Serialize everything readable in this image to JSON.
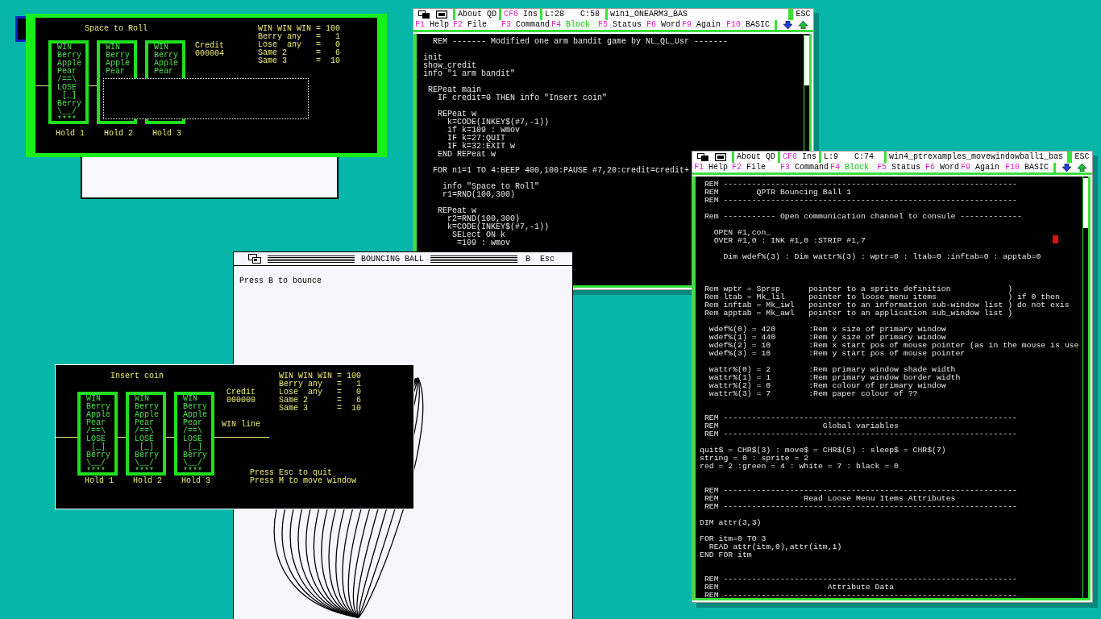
{
  "editors": [
    {
      "about": "About QD",
      "mode_key": "CF6",
      "mode": "Ins",
      "line": "L:28",
      "column": "C:58",
      "file": "win1_ONEARM3_BAS",
      "escape": "ESC",
      "cursor": false,
      "menu": [
        {
          "key": "F1",
          "label": "Help",
          "active": false
        },
        {
          "key": "F2",
          "label": "File",
          "active": false
        },
        {
          "key": "F3",
          "label": "Command",
          "active": false
        },
        {
          "key": "F4",
          "label": "Block",
          "active": true
        },
        {
          "key": "F5",
          "label": "Status",
          "active": false
        },
        {
          "key": "F6",
          "label": "Word",
          "active": false
        },
        {
          "key": "F9",
          "label": "Again",
          "active": false
        },
        {
          "key": "F10",
          "label": "BASIC",
          "active": false
        }
      ],
      "lines": [
        {
          "kind": "code",
          "text": "  REM ------- Modified one arm bandit game by NL_QL_Usr -------"
        },
        {
          "kind": "blank"
        },
        {
          "kind": "code",
          "text": "init"
        },
        {
          "kind": "code",
          "text": "show_credit"
        },
        {
          "kind": "code",
          "text": "info \"1 arm bandit\""
        },
        {
          "kind": "blank"
        },
        {
          "kind": "code",
          "text": " REPeat main"
        },
        {
          "kind": "code",
          "text": "   IF credit=0 THEN info \"Insert coin\""
        },
        {
          "kind": "blank"
        },
        {
          "kind": "code",
          "text": "   REPeat w"
        },
        {
          "kind": "code",
          "text": "     k=CODE(INKEY$(#7,-1))"
        },
        {
          "kind": "code",
          "text": "     if k=109 : wmov"
        },
        {
          "kind": "code",
          "text": "     IF k=27:QUIT"
        },
        {
          "kind": "code",
          "text": "     IF k=32:EXIT w"
        },
        {
          "kind": "code",
          "text": "   END REPeat w"
        },
        {
          "kind": "blank"
        },
        {
          "kind": "code",
          "text": "  FOR n1=1 TO 4:BEEP 400,100:PAUSE #7,20:credit=credit+"
        },
        {
          "kind": "blank"
        },
        {
          "kind": "code",
          "text": "    info \"Space to Roll\""
        },
        {
          "kind": "code",
          "text": "    r1=RND(100,300)"
        },
        {
          "kind": "blank"
        },
        {
          "kind": "code",
          "text": "   REPeat w"
        },
        {
          "kind": "code",
          "text": "     r2=RND(100,300)"
        },
        {
          "kind": "code",
          "text": "     k=CODE(INKEY$(#7,-1))"
        },
        {
          "kind": "code",
          "text": "      SELect ON k"
        },
        {
          "kind": "code",
          "text": "       =109 : wmov"
        }
      ]
    },
    {
      "about": "About QD",
      "mode_key": "CF6",
      "mode": "Ins",
      "line": "L:9",
      "column": "C:74",
      "file": "win4_ptrexamples_movewindowball1_bas",
      "escape": "ESC",
      "cursor": true,
      "menu": [
        {
          "key": "F1",
          "label": "Help",
          "active": false
        },
        {
          "key": "F2",
          "label": "File",
          "active": false
        },
        {
          "key": "F3",
          "label": "Command",
          "active": false
        },
        {
          "key": "F4",
          "label": "Block",
          "active": true
        },
        {
          "key": "F5",
          "label": "Status",
          "active": false
        },
        {
          "key": "F6",
          "label": "Word",
          "active": false
        },
        {
          "key": "F9",
          "label": "Again",
          "active": false
        },
        {
          "key": "F10",
          "label": "BASIC",
          "active": false
        }
      ],
      "lines": [
        {
          "kind": "code",
          "text": " REM --------------------------------------------------------------"
        },
        {
          "kind": "code",
          "text": " REM        QPTR Bouncing Ball 1"
        },
        {
          "kind": "code",
          "text": " REM --------------------------------------------------------------"
        },
        {
          "kind": "blank"
        },
        {
          "kind": "code",
          "text": " Rem ----------- Open communication channel to consule -------------"
        },
        {
          "kind": "blank"
        },
        {
          "kind": "code",
          "text": "   OPEN #1,con_"
        },
        {
          "kind": "code",
          "text": "   OVER #1,0 : INK #1,0 :STRIP #1,7"
        },
        {
          "kind": "blank"
        },
        {
          "kind": "code",
          "text": "     Dim wdef%(3) : Dim wattr%(3) : wptr=0 : ltab=0 :inftab=0 : apptab=0"
        },
        {
          "kind": "blank"
        },
        {
          "kind": "blank"
        },
        {
          "kind": "blank"
        },
        {
          "kind": "code",
          "text": " Rem wptr = Sprsp      pointer to a sprite definition            )"
        },
        {
          "kind": "code",
          "text": " Rem ltab = Mk_lil     pointer to loose menu items               ) if 0 then"
        },
        {
          "kind": "code",
          "text": " Rem inftab = Mk_iwl   pointer to an information sub-window list ) do not exis"
        },
        {
          "kind": "code",
          "text": " Rem apptab = Mk_awl   pointer to an application sub_window list )"
        },
        {
          "kind": "blank"
        },
        {
          "kind": "code",
          "text": "  wdef%(0) = 420       :Rem x size of primary window"
        },
        {
          "kind": "code",
          "text": "  wdef%(1) = 440       :Rem y size of primary window"
        },
        {
          "kind": "code",
          "text": "  wdef%(2) = 10        :Rem x start pos of mouse pointer (as in the mouse is use"
        },
        {
          "kind": "code",
          "text": "  wdef%(3) = 10        :Rem y start pos of mouse pointer"
        },
        {
          "kind": "blank"
        },
        {
          "kind": "code",
          "text": "  wattr%(0) = 2        :Rem primary window shade width"
        },
        {
          "kind": "code",
          "text": "  wattr%(1) = 1        :Rem primary window border width"
        },
        {
          "kind": "code",
          "text": "  wattr%(2) = 0        :Rem colour of primary window"
        },
        {
          "kind": "code",
          "text": "  wattr%(3) = 7        :Rem paper colour of ??"
        },
        {
          "kind": "blank"
        },
        {
          "kind": "blank"
        },
        {
          "kind": "code",
          "text": " REM --------------------------------------------------------------"
        },
        {
          "kind": "code",
          "text": " REM                      Global variables"
        },
        {
          "kind": "code",
          "text": " REM --------------------------------------------------------------"
        },
        {
          "kind": "blank"
        },
        {
          "kind": "code",
          "text": "quit$ = CHR$(3) : move$ = CHR$(5) : sleep$ = CHR$(7)"
        },
        {
          "kind": "code",
          "text": "string = 0 : sprite = 2"
        },
        {
          "kind": "code",
          "text": "red = 2 :green = 4 : white = 7 : black = 0"
        },
        {
          "kind": "blank"
        },
        {
          "kind": "blank"
        },
        {
          "kind": "code",
          "text": " REM --------------------------------------------------------------"
        },
        {
          "kind": "code",
          "text": " REM                  Read Loose Menu Items Attributes"
        },
        {
          "kind": "code",
          "text": " REM --------------------------------------------------------------"
        },
        {
          "kind": "blank"
        },
        {
          "kind": "code",
          "text": "DIM attr(3,3)"
        },
        {
          "kind": "blank"
        },
        {
          "kind": "code",
          "text": "FOR itm=0 TO 3"
        },
        {
          "kind": "code",
          "text": "  READ attr(itm,0),attr(itm,1)"
        },
        {
          "kind": "code",
          "text": "END FOR itm"
        },
        {
          "kind": "blank"
        },
        {
          "kind": "blank"
        },
        {
          "kind": "code",
          "text": " REM --------------------------------------------------------------"
        },
        {
          "kind": "code",
          "text": " REM                       Attribute Data"
        },
        {
          "kind": "code",
          "text": " REM --------------------------------------------------------------"
        }
      ]
    }
  ],
  "bouncing_ball": {
    "title": "BOUNCING BALL",
    "keys": [
      "B",
      "Esc"
    ],
    "message": "Press B to bounce"
  },
  "games": [
    {
      "info": "Space to Roll",
      "overlay": true,
      "reels": [
        {
          "symbols": [
            "WIN",
            "Berry",
            "Apple",
            "Pear",
            "/==\\",
            "LOSE",
            " [_]",
            "Berry",
            "\\__/",
            "****"
          ],
          "hold": "Hold 1"
        },
        {
          "symbols": [
            "WIN",
            "Berry",
            "Apple",
            "Pear"
          ],
          "hold": "Hold 2"
        },
        {
          "symbols": [
            "WIN",
            "Berry",
            "Apple",
            "Pear"
          ],
          "hold": "Hold 3"
        }
      ],
      "credit_label": "Credit",
      "credit": "000004",
      "payouts": [
        "WIN WIN WIN = 100",
        "Berry any   =   1",
        "Lose  any   =   0",
        "Same 2      =   6",
        "Same 3      =  10"
      ]
    },
    {
      "info": "Insert coin",
      "overlay": false,
      "reels": [
        {
          "symbols": [
            "WIN",
            "Berry",
            "Apple",
            "Pear",
            "/==\\",
            "LOSE",
            " [_]",
            "Berry",
            "\\__/",
            "****"
          ],
          "hold": "Hold 1"
        },
        {
          "symbols": [
            "WIN",
            "Berry",
            "Apple",
            "Pear",
            "/==\\",
            "LOSE",
            " [_]",
            "Berry",
            "\\__/",
            "****"
          ],
          "hold": "Hold 2"
        },
        {
          "symbols": [
            "WIN",
            "Berry",
            "Apple",
            "Pear",
            "/==\\",
            "LOSE",
            " [_]",
            "Berry",
            "\\__/",
            "****"
          ],
          "hold": "Hold 3"
        }
      ],
      "credit_label": "Credit",
      "credit": "000000",
      "win_line": "WIN line",
      "payouts": [
        "WIN WIN WIN = 100",
        "Berry any   =   1",
        "Lose  any   =   0",
        "Same 2      =   6",
        "Same 3      =  10"
      ],
      "instructions": [
        "Press Esc to quit",
        "Press M to move window"
      ]
    }
  ]
}
